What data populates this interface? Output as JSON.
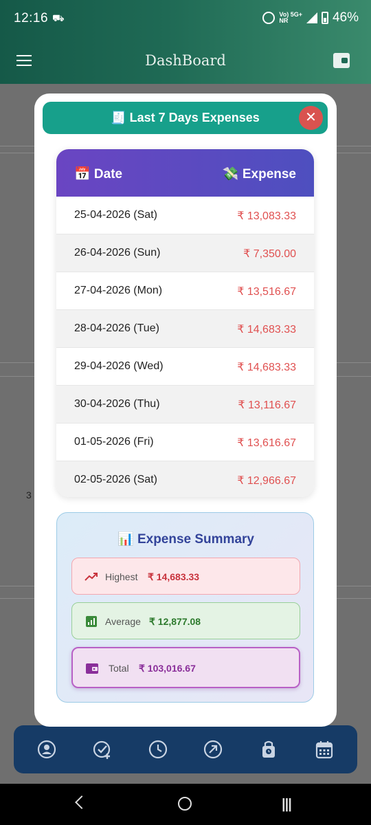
{
  "status_bar": {
    "time": "12:16",
    "network_top": "Vo) 5G+",
    "network_bottom": "NR",
    "battery": "46%"
  },
  "app_bar": {
    "title": "DashBoard"
  },
  "background": {
    "partial_text": "3"
  },
  "modal": {
    "title": "🧾 Last 7 Days Expenses",
    "close_label": "✕",
    "table": {
      "date_header": "📅 Date",
      "expense_header": "💸 Expense",
      "rows": [
        {
          "date": "25-04-2026 (Sat)",
          "expense": "₹ 13,083.33"
        },
        {
          "date": "26-04-2026 (Sun)",
          "expense": "₹ 7,350.00"
        },
        {
          "date": "27-04-2026 (Mon)",
          "expense": "₹ 13,516.67"
        },
        {
          "date": "28-04-2026 (Tue)",
          "expense": "₹ 14,683.33"
        },
        {
          "date": "29-04-2026 (Wed)",
          "expense": "₹ 14,683.33"
        },
        {
          "date": "30-04-2026 (Thu)",
          "expense": "₹ 13,116.67"
        },
        {
          "date": "01-05-2026 (Fri)",
          "expense": "₹ 13,616.67"
        },
        {
          "date": "02-05-2026 (Sat)",
          "expense": "₹ 12,966.67"
        }
      ]
    },
    "summary": {
      "title": "📊 Expense Summary",
      "highest": {
        "label": "Highest",
        "value": "₹ 14,683.33"
      },
      "average": {
        "label": "Average",
        "value": "₹ 12,877.08"
      },
      "total": {
        "label": "Total",
        "value": "₹ 103,016.67"
      }
    }
  },
  "bottom_nav": {
    "icons": [
      "profile-icon",
      "add-check-icon",
      "history-clock-icon",
      "trend-arrow-icon",
      "lock-bag-icon",
      "calendar-icon"
    ]
  },
  "colors": {
    "header_teal": "#17a08b",
    "table_header": "#5a4bc1",
    "expense_red": "#e05050",
    "nav_bg": "#163b66"
  }
}
